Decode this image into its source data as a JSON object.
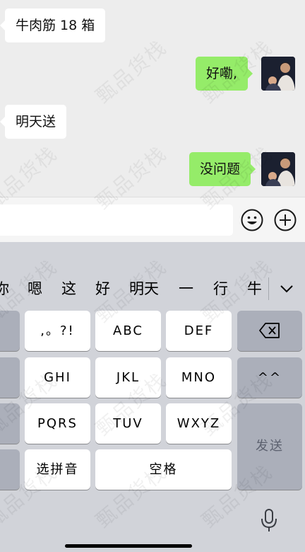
{
  "chat": {
    "messages": [
      {
        "direction": "in",
        "text": "牛肉筋 18 箱"
      },
      {
        "direction": "out",
        "text": "好嘞,"
      },
      {
        "direction": "in",
        "text": "明天送"
      },
      {
        "direction": "out",
        "text": "没问题"
      }
    ]
  },
  "input_bar": {
    "emoji_icon": "smiley-icon",
    "plus_icon": "plus-circle-icon"
  },
  "keyboard": {
    "candidates": [
      "你",
      "嗯",
      "这",
      "好",
      "明天",
      "一",
      "行",
      "牛"
    ],
    "collapse_icon": "chevron-down-icon",
    "keys": {
      "punct": ",。?!",
      "abc": "ABC",
      "def": "DEF",
      "ghi": "GHI",
      "jkl": "JKL",
      "mno": "MNO",
      "pqrs": "PQRS",
      "tuv": "TUV",
      "wxyz": "WXYZ",
      "pinyin": "选拼音",
      "space": "空格",
      "emoticon": "^^",
      "send": "发送"
    },
    "icons": {
      "backspace": "backspace-icon",
      "mic": "microphone-icon"
    }
  },
  "watermark": "甄品货栈"
}
